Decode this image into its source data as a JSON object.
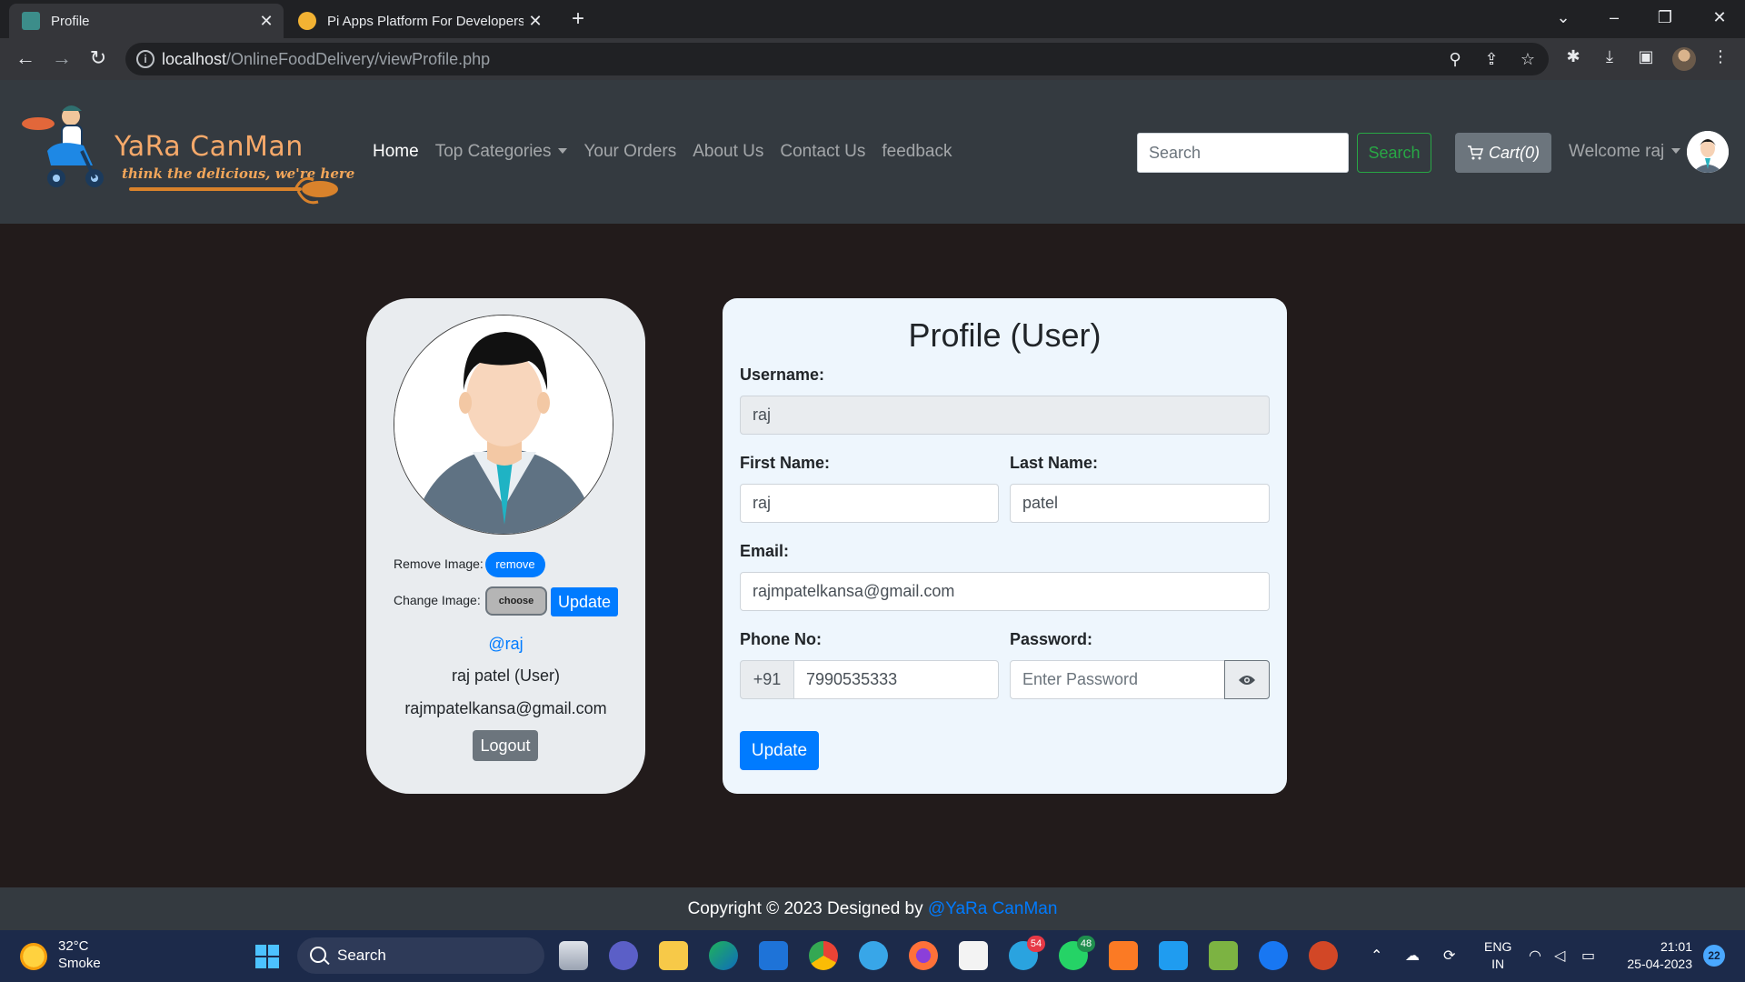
{
  "browser": {
    "tabs": [
      {
        "title": "Profile"
      },
      {
        "title": "Pi Apps Platform For Developers"
      }
    ],
    "url_host": "localhost",
    "url_path": "/OnlineFoodDelivery/viewProfile.php"
  },
  "site": {
    "brand": "YaRa CanMan",
    "tagline": "think the delicious, we're here",
    "menu": {
      "home": "Home",
      "categories": "Top Categories",
      "orders": "Your Orders",
      "about": "About Us",
      "contact": "Contact Us",
      "feedback": "feedback"
    },
    "search_placeholder": "Search",
    "search_button": "Search",
    "cart": "Cart(0)",
    "welcome": "Welcome raj"
  },
  "profile_card": {
    "remove_label": "Remove Image:",
    "remove_button": "remove",
    "change_label": "Change Image:",
    "choose_button": "choose",
    "update_button": "Update",
    "handle": "@raj",
    "fullname": "raj patel (User)",
    "email": "rajmpatelkansa@gmail.com",
    "logout_button": "Logout"
  },
  "form": {
    "title": "Profile (User)",
    "username_label": "Username:",
    "username_value": "raj",
    "firstname_label": "First Name:",
    "firstname_value": "raj",
    "lastname_label": "Last Name:",
    "lastname_value": "patel",
    "email_label": "Email:",
    "email_value": "rajmpatelkansa@gmail.com",
    "phone_label": "Phone No:",
    "phone_prefix": "+91",
    "phone_value": "7990535333",
    "password_label": "Password:",
    "password_placeholder": "Enter Password",
    "submit_button": "Update"
  },
  "footer": {
    "text": "Copyright © 2023 Designed by ",
    "link": "@YaRa CanMan"
  },
  "taskbar": {
    "temperature": "32°C",
    "weather": "Smoke",
    "search": "Search",
    "telegram_badge": "54",
    "whatsapp_badge": "48",
    "lang_top": "ENG",
    "lang_bottom": "IN",
    "time": "21:01",
    "date": "25-04-2023",
    "notifications": "22"
  },
  "colors": {
    "page_bg": "#221b1b",
    "navbar_bg": "#343a40",
    "primary": "#007bff",
    "success": "#28a745",
    "secondary": "#6c757d"
  }
}
